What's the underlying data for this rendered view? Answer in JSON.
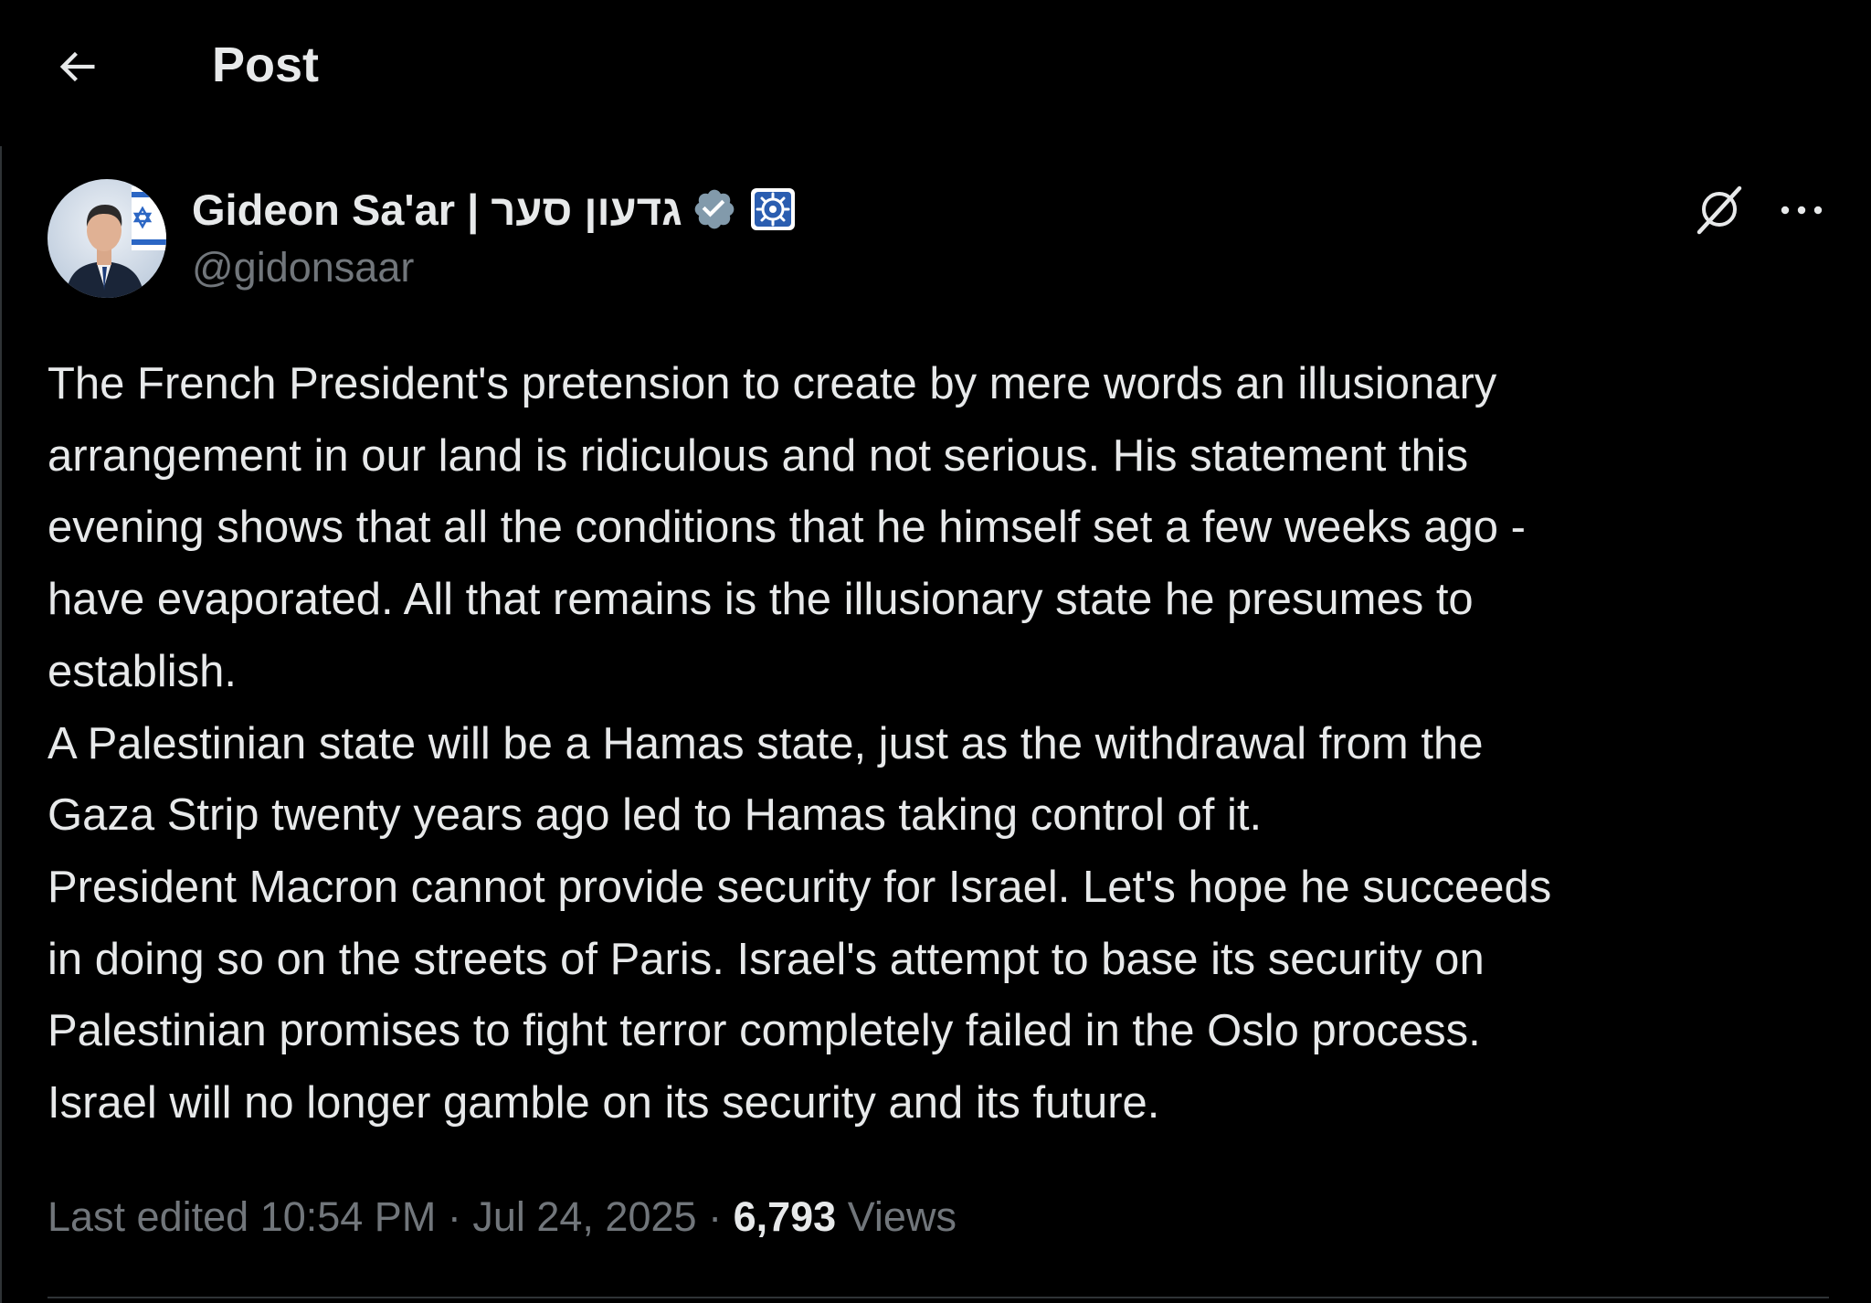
{
  "header": {
    "title": "Post",
    "back_icon": "arrow-left-icon"
  },
  "author": {
    "display_name": "Gideon Sa'ar | גדעון סער",
    "handle": "@gidonsaar",
    "verified_icon": "verified-badge-icon",
    "affiliation_icon": "government-affiliation-icon",
    "avatar_icon": "avatar"
  },
  "actions": {
    "grok_icon": "grok-icon",
    "more_icon": "more-options-icon"
  },
  "post": {
    "lines": [
      "The French President's pretension to create by mere words an illusionary",
      "arrangement in our land is ridiculous and not serious. His statement this",
      "evening shows that all the conditions that he himself set a few weeks ago -",
      "have evaporated. All that remains is the illusionary state he presumes to",
      "establish.",
      "A Palestinian state will be a Hamas state, just as the withdrawal from the",
      "Gaza Strip twenty years ago led to Hamas taking control of it.",
      "President Macron cannot provide security for Israel. Let's hope he succeeds",
      "in doing so on the streets of Paris. Israel's attempt to base its security on",
      "Palestinian promises to fight terror completely failed in the Oslo process.",
      "Israel will no longer gamble on its security and its future."
    ]
  },
  "meta": {
    "edited_label": "Last edited",
    "time": "10:54 PM",
    "separator": "·",
    "date": "Jul 24, 2025",
    "views_count": "6,793",
    "views_label": "Views"
  },
  "colors": {
    "background": "#000000",
    "text_primary": "#e7e9ea",
    "text_secondary": "#71767b",
    "verified_badge": "#829aab",
    "divider": "#2f3336"
  }
}
